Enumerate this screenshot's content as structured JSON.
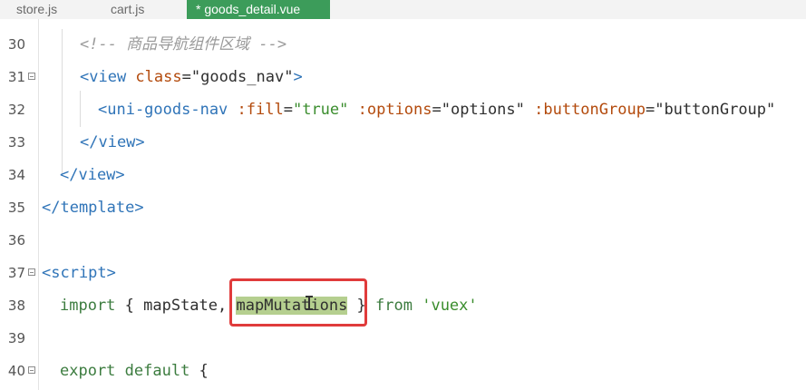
{
  "tabs": [
    {
      "label": "store.js"
    },
    {
      "label": "cart.js"
    },
    {
      "label": "* goods_detail.vue"
    }
  ],
  "lines": [
    {
      "n": "30",
      "parts": [
        "<!-- 商品导航组件区域 -->"
      ]
    },
    {
      "n": "31",
      "parts": [
        "<view",
        " class",
        "=",
        "\"goods_nav\"",
        ">"
      ]
    },
    {
      "n": "32",
      "parts": [
        "<uni-goods-nav",
        " :fill",
        "=",
        "\"true\"",
        " :options",
        "=",
        "\"options\"",
        " :buttonGroup",
        "=",
        "\"buttonGroup\""
      ]
    },
    {
      "n": "33",
      "parts": [
        "</view>"
      ]
    },
    {
      "n": "34",
      "parts": [
        "</view>"
      ]
    },
    {
      "n": "35",
      "parts": [
        "</template>"
      ]
    },
    {
      "n": "36",
      "parts": [
        ""
      ]
    },
    {
      "n": "37",
      "parts": [
        "<script>"
      ]
    },
    {
      "n": "38",
      "parts": [
        "import",
        " { mapState, ",
        "mapMutations",
        " } ",
        "from",
        " 'vuex'"
      ]
    },
    {
      "n": "39",
      "parts": [
        ""
      ]
    },
    {
      "n": "40",
      "parts": [
        "export",
        " default",
        " {"
      ]
    }
  ]
}
